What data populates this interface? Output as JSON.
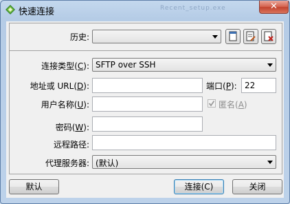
{
  "window": {
    "title": "快速连接",
    "background_hint": "Recent_setup.exe",
    "close_glyph": "✕"
  },
  "history": {
    "label": "历史:",
    "value": ""
  },
  "form": {
    "conn_type_label": "连接类型",
    "conn_type_key": "C",
    "conn_type_value": "SFTP over SSH",
    "address_label": "地址或 URL",
    "address_key": "D",
    "address_value": "",
    "port_label": "端口",
    "port_key": "P",
    "port_value": "22",
    "username_label": "用户名称",
    "username_key": "U",
    "username_value": "",
    "anonymous_label": "匿名",
    "anonymous_key": "A",
    "anonymous_checked": true,
    "password_label": "密码",
    "password_key": "W",
    "password_value": "",
    "remote_path_label": "远程路径:",
    "remote_path_value": "",
    "proxy_label": "代理服务器:",
    "proxy_value": "(默认)"
  },
  "buttons": {
    "default_label": "默认",
    "connect_label": "连接(C)",
    "close_label": "关闭"
  }
}
